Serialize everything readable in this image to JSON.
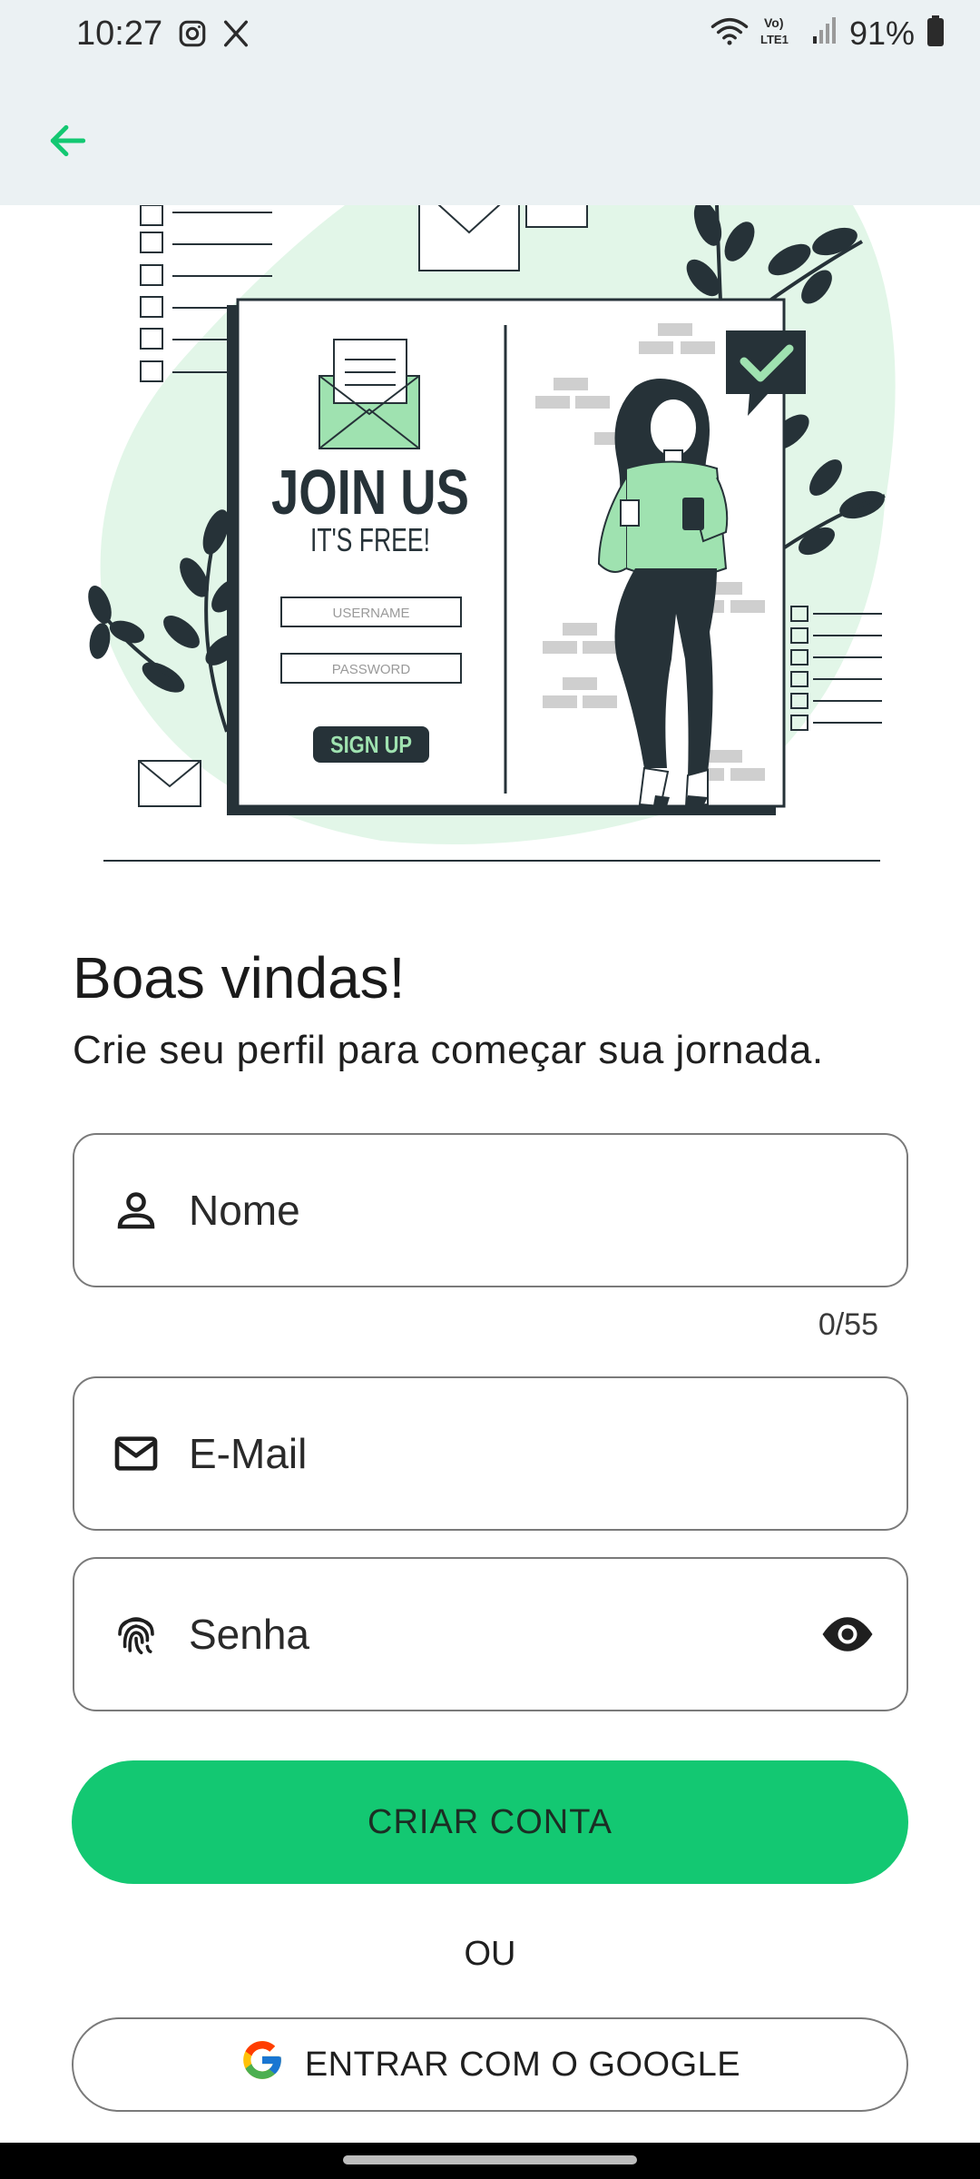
{
  "status_bar": {
    "time": "10:27",
    "battery": "91%",
    "left_icons": [
      "instagram-icon",
      "x-icon"
    ],
    "right_icons": [
      "wifi-icon",
      "volte-icon",
      "signal-icon",
      "battery-icon"
    ]
  },
  "app_bar": {
    "back_icon": "arrow-left-icon",
    "accent_color": "#13c872"
  },
  "illustration": {
    "heading": "JOIN US",
    "subheading": "IT'S FREE!",
    "username_placeholder": "USERNAME",
    "password_placeholder": "PASSWORD",
    "button_label": "SIGN UP"
  },
  "welcome": {
    "title": "Boas vindas!",
    "subtitle": "Crie seu perfil para começar sua jornada."
  },
  "form": {
    "name": {
      "placeholder": "Nome",
      "icon": "person-icon",
      "counter": "0/55"
    },
    "email": {
      "placeholder": "E-Mail",
      "icon": "mail-icon"
    },
    "password": {
      "placeholder": "Senha",
      "icon": "fingerprint-icon",
      "toggle_icon": "eye-icon"
    }
  },
  "actions": {
    "create_account": "CRIAR CONTA",
    "or": "OU",
    "google": "ENTRAR COM O GOOGLE"
  },
  "colors": {
    "primary": "#13c872",
    "header_bg": "#ebf1f3",
    "illustration_green": "#9fe2b0",
    "illustration_dark": "#263238"
  }
}
